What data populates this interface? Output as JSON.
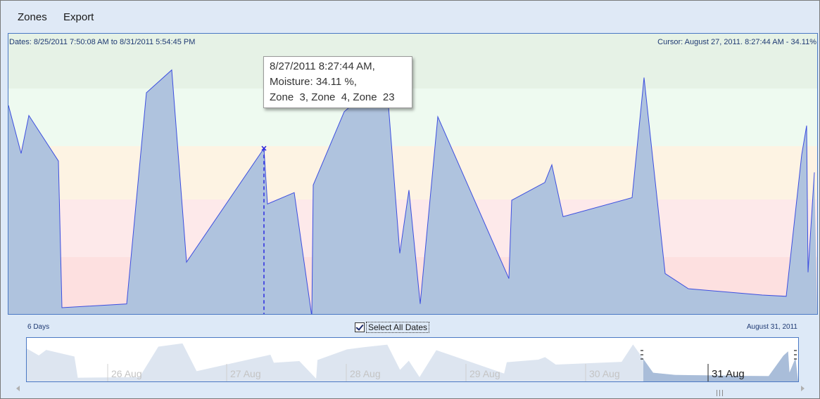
{
  "menu": {
    "items": [
      "Zones",
      "Export"
    ]
  },
  "plot": {
    "dates_text": "Dates: 8/25/2011 7:50:08 AM to 8/31/2011 5:54:45 PM",
    "cursor_text": "Cursor: August 27, 2011. 8:27:44 AM - 34.11%"
  },
  "tooltip": {
    "lines": [
      "8/27/2011 8:27:44 AM,",
      "Moisture: 34.11 %,",
      "Zone  3, Zone  4, Zone  23"
    ]
  },
  "range": {
    "duration": "6 Days",
    "end_date": "August 31, 2011"
  },
  "select_all": {
    "label": "Select All Dates",
    "checked": true
  },
  "colors": {
    "series_fill": "#afc3de",
    "series_line": "#3d4fe0",
    "plot_border": "#4a78c4",
    "band_green": "#e6f2e6",
    "band_mint": "#eefaf0",
    "band_yellow": "#fdf3e3",
    "band_rose": "#fde9ea",
    "band_red": "#fde0e0"
  },
  "chart_data": {
    "type": "area",
    "series": [
      {
        "values": [
          0.825,
          0.635,
          0.785,
          0.605,
          0.025,
          0.04,
          0.875,
          0.965,
          0.205,
          0.655,
          0.435,
          0.48,
          -0.01,
          0.51,
          0.8,
          0.86,
          0.93,
          0.24,
          0.49,
          0.04,
          0.78,
          0.14,
          0.45,
          0.52,
          0.59,
          0.385,
          0.46,
          0.935,
          0.16,
          0.1,
          0.075,
          0.07,
          0.63,
          0.745,
          0.165,
          0.56
        ]
      }
    ],
    "cursor": {
      "date": "August 27, 2011. 8:27:44 AM",
      "value": 34.11
    },
    "navigator_ticks": [
      "26 Aug",
      "27 Aug",
      "28 Aug",
      "29 Aug",
      "30 Aug",
      "31 Aug"
    ],
    "grid": false
  }
}
